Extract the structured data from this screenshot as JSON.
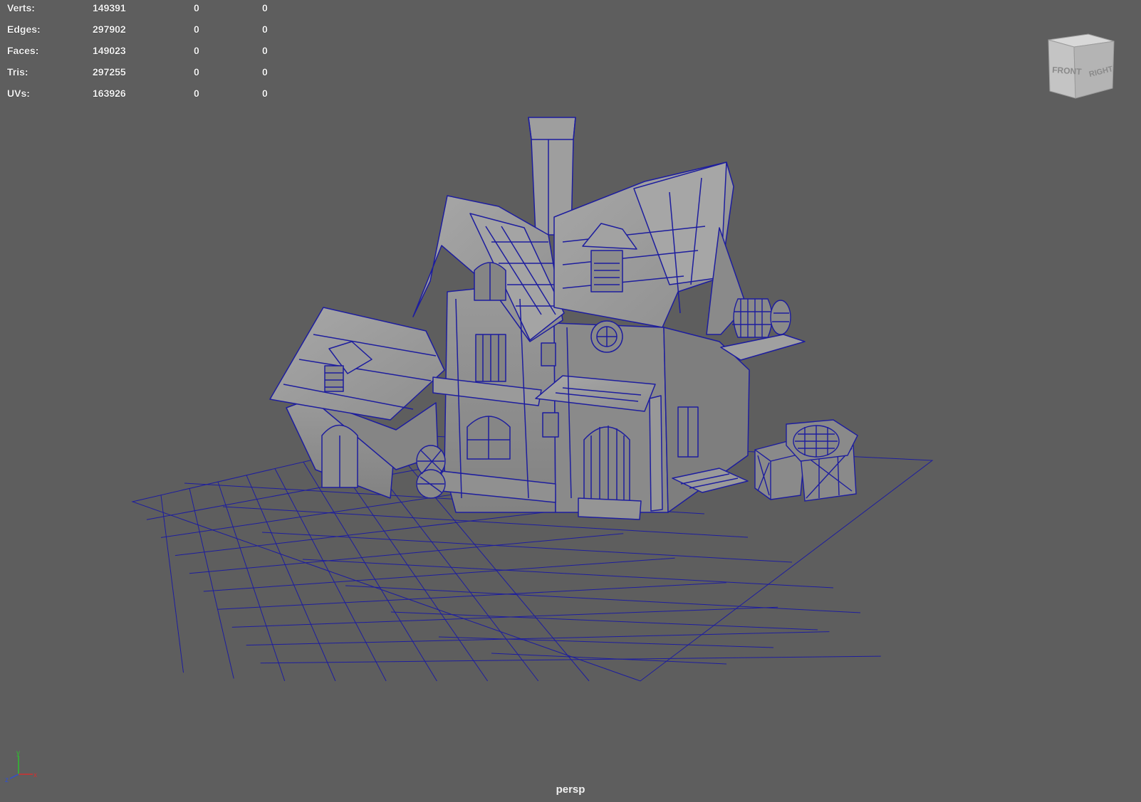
{
  "hud": {
    "rows": [
      {
        "label": "Verts:",
        "total": "149391",
        "selected": "0",
        "components": "0"
      },
      {
        "label": "Edges:",
        "total": "297902",
        "selected": "0",
        "components": "0"
      },
      {
        "label": "Faces:",
        "total": "149023",
        "selected": "0",
        "components": "0"
      },
      {
        "label": "Tris:",
        "total": "297255",
        "selected": "0",
        "components": "0"
      },
      {
        "label": "UVs:",
        "total": "163926",
        "selected": "0",
        "components": "0"
      }
    ]
  },
  "view_cube": {
    "front": "FRONT",
    "right": "RIGHT"
  },
  "axis": {
    "x": "x",
    "y": "y",
    "z": "z"
  },
  "camera": "persp",
  "colors": {
    "background": "#5e5e5e",
    "wireframe": "#1d1d9e",
    "model_fill": "#8c8c8c"
  }
}
